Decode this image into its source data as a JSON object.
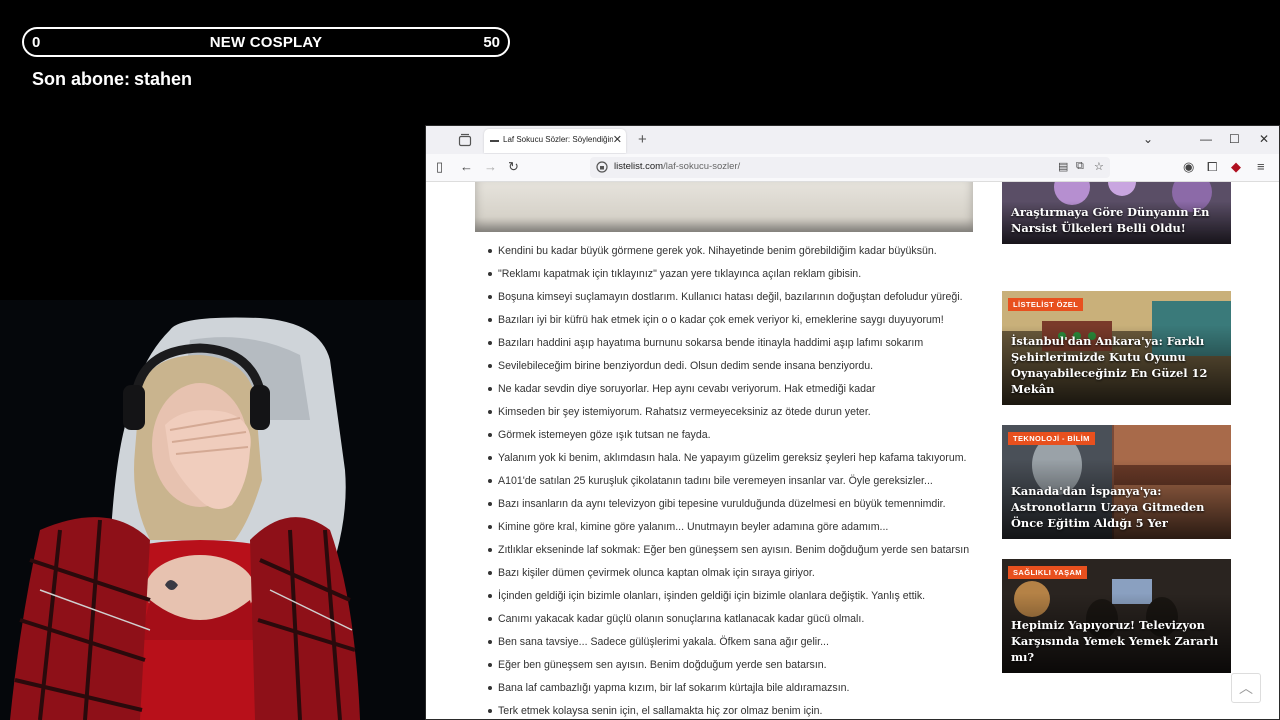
{
  "overlay": {
    "goal_min": "0",
    "goal_title": "NEW COSPLAY",
    "goal_max": "50",
    "last_sub_label": "Son abone:",
    "last_sub_name": "stahen"
  },
  "browser": {
    "tab_title": "Laf Sokucu Sözler: Söylendiğinde",
    "url_host": "listelist.com",
    "url_path": "/laf-sokucu-sozler/"
  },
  "quotes": [
    "Kendini bu kadar büyük görmene gerek yok. Nihayetinde benim görebildiğim kadar büyüksün.",
    "\"Reklamı kapatmak için tıklayınız\" yazan yere tıklayınca açılan reklam gibisin.",
    "Boşuna kimseyi suçlamayın dostlarım. Kullanıcı hatası değil, bazılarının doğuştan defoludur yüreği.",
    "Bazıları iyi bir küfrü hak etmek için o o kadar çok emek veriyor ki, emeklerine saygı duyuyorum!",
    "Bazıları haddini aşıp hayatıma burnunu sokarsa bende itinayla haddimi aşıp lafımı sokarım",
    "Sevilebileceğim birine benziyordun dedi. Olsun dedim sende insana benziyordu.",
    "Ne kadar sevdin diye soruyorlar. Hep aynı cevabı veriyorum. Hak etmediği kadar",
    "Kimseden bir şey istemiyorum. Rahatsız vermeyeceksiniz az ötede durun yeter.",
    "Görmek istemeyen göze ışık tutsan ne fayda.",
    "Yalanım yok ki benim, aklımdasın hala. Ne yapayım güzelim gereksiz şeyleri hep kafama takıyorum.",
    "A101'de satılan 25 kuruşluk çikolatanın tadını bile veremeyen insanlar var. Öyle gereksizler...",
    "Bazı insanların da aynı televizyon gibi tepesine vurulduğunda düzelmesi en büyük temennimdir.",
    "Kimine göre kral, kimine göre yalanım... Unutmayın beyler adamına göre adamım...",
    "Zıtlıklar ekseninde laf sokmak: Eğer ben güneşsem sen ayısın. Benim doğduğum yerde sen batarsın",
    "Bazı kişiler dümen çevirmek olunca kaptan olmak için sıraya giriyor.",
    "İçinden geldiği için bizimle olanları, işinden geldiği için bizimle olanlara değiştik. Yanlış ettik.",
    "Canımı yakacak kadar güçlü olanın sonuçlarına katlanacak kadar gücü olmalı.",
    "Ben sana tavsiye... Sadece gülüşlerimi yakala. Öfkem sana ağır gelir...",
    "Eğer ben güneşsem sen ayısın. Benim doğduğum yerde sen batarsın.",
    "Bana laf cambazlığı yapma kızım, bir laf sokarım kürtajla bile aldıramazsın.",
    "Terk etmek kolaysa senin için, el sallamakta hiç zor olmaz benim için."
  ],
  "sidebar": {
    "cards": [
      {
        "badge": "",
        "title": "Araştırmaya Göre Dünyanın En Narsist Ülkeleri Belli Oldu!"
      },
      {
        "badge": "LİSTELİST ÖZEL",
        "title": "İstanbul'dan Ankara'ya: Farklı Şehirlerimizde Kutu Oyunu Oynayabileceğiniz En Güzel 12 Mekân"
      },
      {
        "badge": "TEKNOLOJİ - BİLİM",
        "title": "Kanada'dan İspanya'ya: Astronotların Uzaya Gitmeden Önce Eğitim Aldığı 5 Yer"
      },
      {
        "badge": "SAĞLIKLI YAŞAM",
        "title": "Hepimiz Yapıyoruz! Televizyon Karşısında Yemek Yemek Zararlı mı?"
      }
    ]
  },
  "colors": {
    "badge": "#e8501e",
    "shirt": "#b8101a",
    "background": "#000000"
  }
}
